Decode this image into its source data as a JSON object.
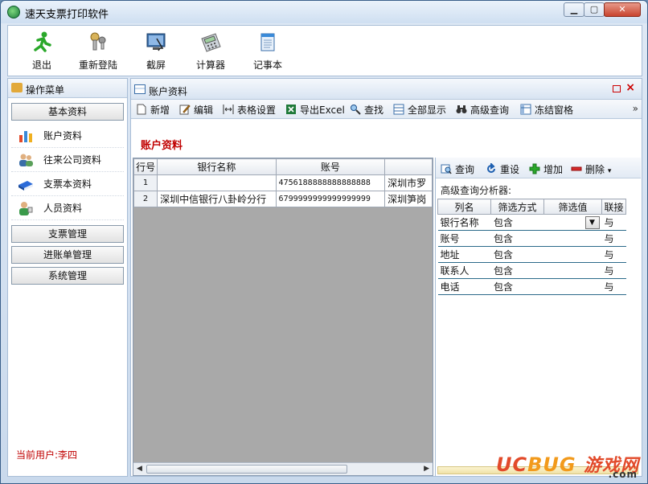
{
  "window": {
    "title": "速天支票打印软件",
    "min": "▁",
    "max": "▢",
    "close": "✕"
  },
  "main_toolbar": [
    {
      "label": "退出",
      "icon": "exit-icon"
    },
    {
      "label": "重新登陆",
      "icon": "relogin-icon"
    },
    {
      "label": "截屏",
      "icon": "screenshot-icon"
    },
    {
      "label": "计算器",
      "icon": "calculator-icon"
    },
    {
      "label": "记事本",
      "icon": "notepad-icon"
    }
  ],
  "sidebar": {
    "header": "操作菜单",
    "group1": "基本资料",
    "items": [
      {
        "label": "账户资料",
        "icon": "bar-chart-icon"
      },
      {
        "label": "往来公司资料",
        "icon": "users-icon"
      },
      {
        "label": "支票本资料",
        "icon": "book-icon"
      },
      {
        "label": "人员资料",
        "icon": "person-icon"
      }
    ],
    "group2": "支票管理",
    "group3": "进账单管理",
    "group4": "系统管理",
    "current_user": "当前用户:李四"
  },
  "content": {
    "tab_title": "账户资料",
    "toolbar": {
      "new": "新增",
      "edit": "编辑",
      "grid_settings": "表格设置",
      "export": "导出Excel",
      "find": "查找",
      "show_all": "全部显示",
      "advanced": "高级查询",
      "freeze": "冻结窗格",
      "more": "»"
    },
    "section_title": "账户资料",
    "grid": {
      "headers": [
        "行号",
        "银行名称",
        "账号",
        ""
      ],
      "rows": [
        {
          "n": "1",
          "bank": "",
          "account": "4756188888888888888",
          "addr": "深圳市罗"
        },
        {
          "n": "2",
          "bank": "深圳中信银行八卦岭分行",
          "account": "6799999999999999999",
          "addr": "深圳笋岗"
        }
      ]
    },
    "query_panel": {
      "query": "查询",
      "reset": "重设",
      "add": "增加",
      "delete": "删除",
      "label": "高级查询分析器:",
      "headers": [
        "列名",
        "筛选方式",
        "筛选值",
        "联接"
      ],
      "rows": [
        {
          "col": "银行名称",
          "mode": "包含",
          "value": "",
          "join": "与"
        },
        {
          "col": "账号",
          "mode": "包含",
          "value": "",
          "join": "与"
        },
        {
          "col": "地址",
          "mode": "包含",
          "value": "",
          "join": "与"
        },
        {
          "col": "联系人",
          "mode": "包含",
          "value": "",
          "join": "与"
        },
        {
          "col": "电话",
          "mode": "包含",
          "value": "",
          "join": "与"
        }
      ]
    }
  },
  "watermark": {
    "uc": "UC",
    "bug": "BUG",
    "cn": "游戏网",
    "com": ".com"
  }
}
